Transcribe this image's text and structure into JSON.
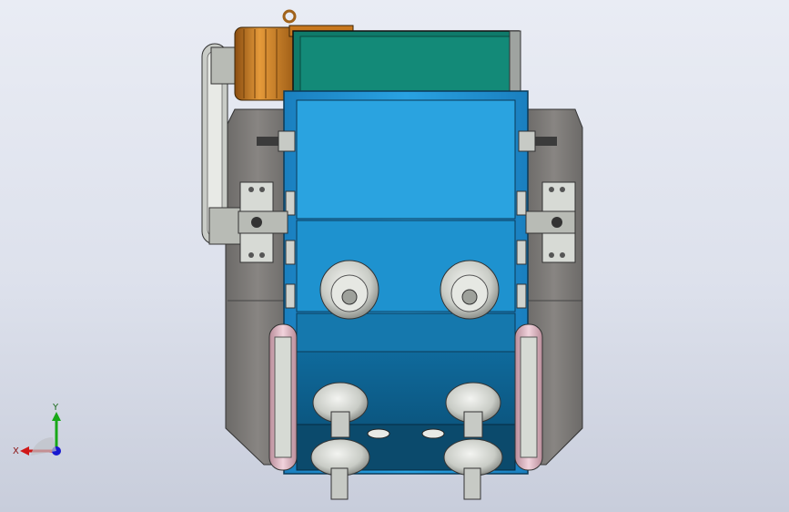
{
  "viewport": {
    "description_free": true
  },
  "triad": {
    "x_label": "X",
    "y_label": "Y"
  },
  "colors": {
    "background_top": "#e9ecf4",
    "background_bottom": "#c8cddb",
    "housing_gray": "#7d7a78",
    "frame_blue": "#1f8fcf",
    "frame_blue_dark": "#0e5f8f",
    "hopper_teal": "#0f7a6a",
    "motor_orange": "#c8781e",
    "bearing_light": "#d9dcd8",
    "axis_x": "#d01818",
    "axis_y": "#18a818",
    "axis_z": "#1818d0"
  },
  "icons": {
    "triad": "coordinate-triad-icon"
  }
}
